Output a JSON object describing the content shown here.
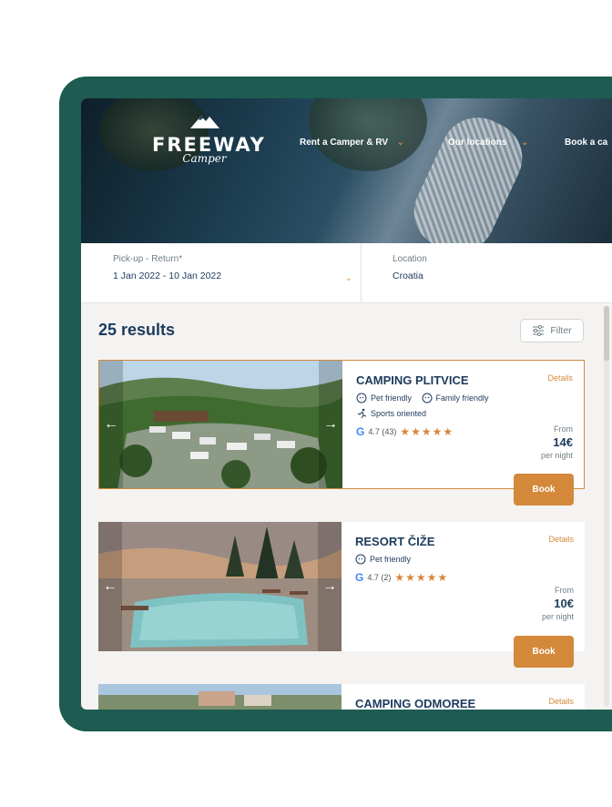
{
  "brand": {
    "name": "FREEWAY",
    "sub": "Camper"
  },
  "nav": [
    {
      "label": "Rent a Camper & RV"
    },
    {
      "label": "Our locations"
    },
    {
      "label": "Book a ca"
    }
  ],
  "search": {
    "pickup_label": "Pick-up - Return*",
    "pickup_value": "1 Jan 2022 - 10 Jan 2022",
    "location_label": "Location",
    "location_value": "Croatia"
  },
  "results": {
    "title": "25 results",
    "filter_label": "Filter"
  },
  "cards": [
    {
      "title": "CAMPING PLITVICE",
      "details": "Details",
      "tags": [
        "Pet friendly",
        "Family friendly",
        "Sports oriented"
      ],
      "rating_text": "4.7 (43)",
      "stars": "★★★★★",
      "from": "From",
      "price": "14€",
      "unit": "per night",
      "book": "Book"
    },
    {
      "title": "RESORT ČIŽE",
      "details": "Details",
      "tags": [
        "Pet friendly"
      ],
      "rating_text": "4.7 (2)",
      "stars": "★★★★★",
      "from": "From",
      "price": "10€",
      "unit": "per night",
      "book": "Book"
    },
    {
      "title": "CAMPING ODMOREE",
      "details": "Details"
    }
  ],
  "colors": {
    "accent": "#d4883a",
    "navy": "#1d3a5c",
    "device": "#1e5b52"
  }
}
